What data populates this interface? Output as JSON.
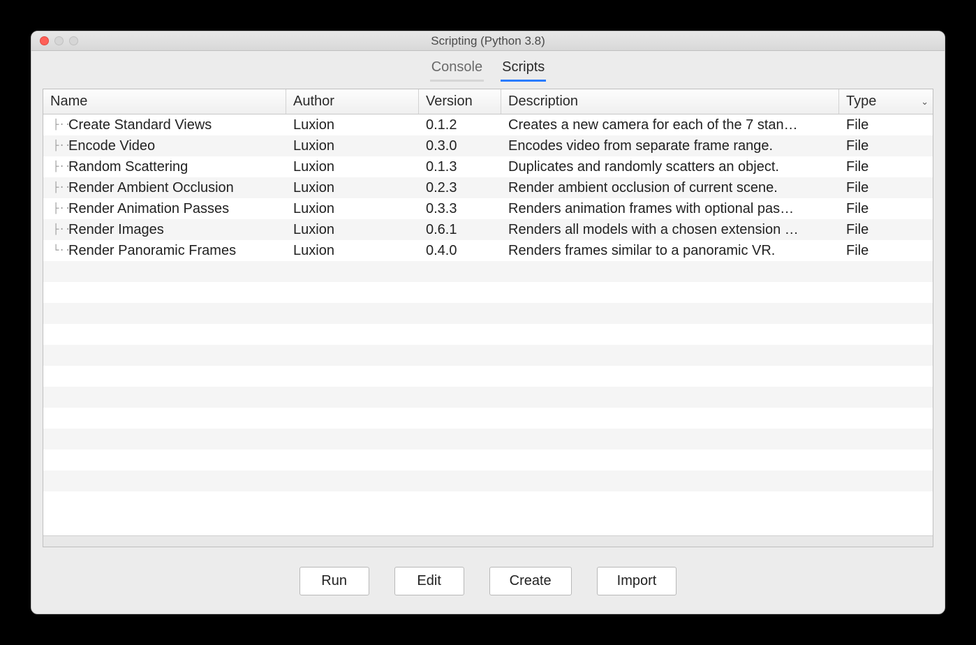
{
  "window": {
    "title": "Scripting (Python 3.8)"
  },
  "tabs": {
    "console": "Console",
    "scripts": "Scripts",
    "active": "scripts"
  },
  "table": {
    "headers": {
      "name": "Name",
      "author": "Author",
      "version": "Version",
      "description": "Description",
      "type": "Type"
    },
    "rows": [
      {
        "name": "Create Standard Views",
        "author": "Luxion",
        "version": "0.1.2",
        "description": "Creates a new camera for each of the 7 stan…",
        "type": "File"
      },
      {
        "name": "Encode Video",
        "author": "Luxion",
        "version": "0.3.0",
        "description": "Encodes video from separate frame range.",
        "type": "File"
      },
      {
        "name": "Random Scattering",
        "author": "Luxion",
        "version": "0.1.3",
        "description": "Duplicates and randomly scatters an object.",
        "type": "File"
      },
      {
        "name": "Render Ambient Occlusion",
        "author": "Luxion",
        "version": "0.2.3",
        "description": "Render ambient occlusion of current scene.",
        "type": "File"
      },
      {
        "name": "Render Animation Passes",
        "author": "Luxion",
        "version": "0.3.3",
        "description": "Renders animation frames with optional pas…",
        "type": "File"
      },
      {
        "name": "Render Images",
        "author": "Luxion",
        "version": "0.6.1",
        "description": "Renders all models with a chosen extension …",
        "type": "File"
      },
      {
        "name": "Render Panoramic Frames",
        "author": "Luxion",
        "version": "0.4.0",
        "description": "Renders frames similar to a panoramic VR.",
        "type": "File"
      }
    ]
  },
  "buttons": {
    "run": "Run",
    "edit": "Edit",
    "create": "Create",
    "import": "Import"
  }
}
